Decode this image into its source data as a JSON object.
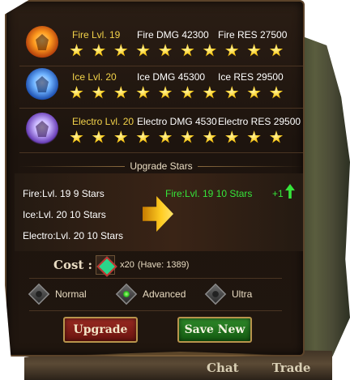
{
  "background": {
    "bottom_tabs": [
      "Chat",
      "Trade"
    ]
  },
  "elements": [
    {
      "icon": "fire-emblem-icon",
      "name": "Fire Lvl. 19",
      "dmg": "Fire DMG 42300",
      "res": "Fire RES 27500",
      "stars": 10
    },
    {
      "icon": "ice-emblem-icon",
      "name": "Ice Lvl. 20",
      "dmg": "Ice DMG 45300",
      "res": "Ice RES 29500",
      "stars": 10
    },
    {
      "icon": "electro-emblem-icon",
      "name": "Electro Lvl. 20",
      "dmg": "Electro DMG 4530",
      "res": "Electro RES 29500",
      "stars": 10
    }
  ],
  "upgrade_section": {
    "title": "Upgrade Stars",
    "current": [
      "Fire:Lvl. 19 9 Stars",
      "Ice:Lvl. 20 10 Stars",
      "Electro:Lvl. 20 10 Stars"
    ],
    "new": "Fire:Lvl. 19 10 Stars",
    "delta": "+1",
    "colors": {
      "new_value": "#36e53a",
      "name_highlight": "#f2d24a"
    }
  },
  "cost": {
    "label": "Cost :",
    "item_icon": "crystal-item-icon",
    "quantity": "x20",
    "have": "(Have: 1389)"
  },
  "options": [
    {
      "label": "Normal",
      "selected": false
    },
    {
      "label": "Advanced",
      "selected": true
    },
    {
      "label": "Ultra",
      "selected": false
    }
  ],
  "buttons": {
    "upgrade": "Upgrade",
    "save": "Save New"
  }
}
